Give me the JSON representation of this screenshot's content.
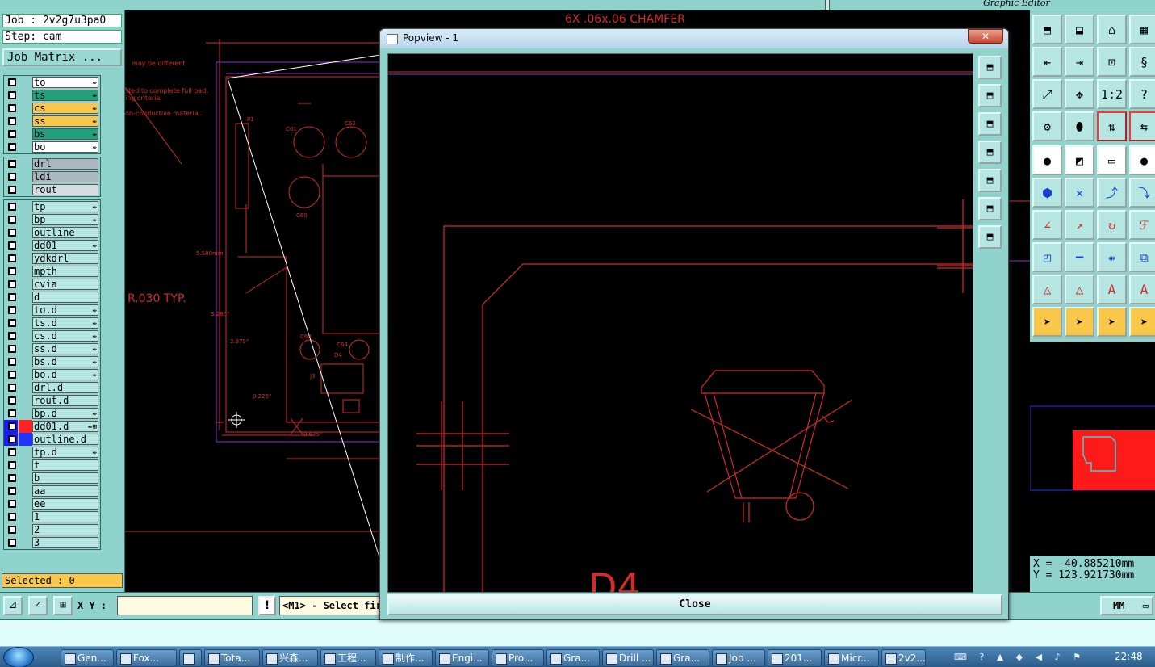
{
  "app": {
    "title": "Graphic Editor"
  },
  "job": {
    "label": "Job : 2v2g7u3pa0",
    "step": "Step: cam",
    "matrix_button": "Job Matrix ..."
  },
  "layers_board": [
    {
      "name": "to",
      "color": "#ffffff",
      "icon": "✒"
    },
    {
      "name": "ts",
      "color": "#22a07c",
      "icon": "✒"
    },
    {
      "name": "cs",
      "color": "#f9c84a",
      "icon": "✒"
    },
    {
      "name": "ss",
      "color": "#f9c84a",
      "icon": "✒"
    },
    {
      "name": "bs",
      "color": "#22a07c",
      "icon": "✒"
    },
    {
      "name": "bo",
      "color": "#ffffff",
      "icon": "✒"
    }
  ],
  "layers_drill": [
    {
      "name": "drl",
      "color": "#aab7bf"
    },
    {
      "name": "ldi",
      "color": "#aab7bf"
    },
    {
      "name": "rout",
      "color": "#d6dde0"
    }
  ],
  "layers_misc": [
    {
      "name": "tp",
      "icon": "✒"
    },
    {
      "name": "bp",
      "icon": "✒"
    },
    {
      "name": "outline",
      "icon": ""
    },
    {
      "name": "dd01",
      "icon": "✒"
    },
    {
      "name": "ydkdrl",
      "icon": ""
    },
    {
      "name": "mpth",
      "icon": ""
    },
    {
      "name": "cvia",
      "icon": ""
    },
    {
      "name": "d",
      "icon": ""
    },
    {
      "name": "to.d",
      "icon": "✒"
    },
    {
      "name": "ts.d",
      "icon": "✒"
    },
    {
      "name": "cs.d",
      "icon": "✒"
    },
    {
      "name": "ss.d",
      "icon": "✒"
    },
    {
      "name": "bs.d",
      "icon": "✒"
    },
    {
      "name": "bo.d",
      "icon": "✒"
    },
    {
      "name": "drl.d",
      "icon": ""
    },
    {
      "name": "rout.d",
      "icon": ""
    },
    {
      "name": "bp.d",
      "icon": "✒"
    },
    {
      "name": "dd01.d",
      "icon": "✒⊞",
      "swatch": "#ff2222"
    },
    {
      "name": "outline.d",
      "icon": "",
      "swatch": "#2233ff"
    },
    {
      "name": "tp.d",
      "icon": "✒"
    },
    {
      "name": "t",
      "icon": ""
    },
    {
      "name": "b",
      "icon": ""
    },
    {
      "name": "aa",
      "icon": ""
    },
    {
      "name": "ee",
      "icon": ""
    },
    {
      "name": "1",
      "icon": ""
    },
    {
      "name": "2",
      "icon": ""
    },
    {
      "name": "3",
      "icon": ""
    }
  ],
  "selected": "Selected : 0",
  "bottom": {
    "xy_label": "X Y :",
    "xy_value": "",
    "message": "<M1> - Select fir",
    "units": "MM"
  },
  "drawing_text": {
    "chamfer": "6X .06x.06 CHAMFER",
    "radius": "R.030 TYP.",
    "note1": "may be different",
    "note2": "sted to complete full pad.",
    "note3": "ing criteria:",
    "note4": "on-conductive material.",
    "dim1": "5.580mm",
    "dim2": "3.280\"",
    "dim3": "2.375\"",
    "dim4": "0.225\"",
    "dim5": "0.675\"",
    "ref_p1": "P1",
    "ref_c61": "C61",
    "ref_c62": "C62",
    "ref_c60": "C60",
    "ref_c63": "C63",
    "ref_c64": "C64",
    "ref_d4": "D4",
    "ref_j3": "J3",
    "pop_label": "D4"
  },
  "popview": {
    "title": "Popview - 1",
    "close_label": "Close"
  },
  "coords": {
    "x": "X = -40.885210mm",
    "y": "Y = 123.921730mm"
  },
  "taskbar": {
    "items": [
      "Gen...",
      "Fox...",
      "",
      "Tota...",
      "兴森...",
      "工程...",
      "制作...",
      "Engi...",
      "Pro...",
      "Gra...",
      "Drill ...",
      "Gra...",
      "Job ...",
      "201...",
      "Micr...",
      "2v2..."
    ],
    "clock": "22:48"
  }
}
